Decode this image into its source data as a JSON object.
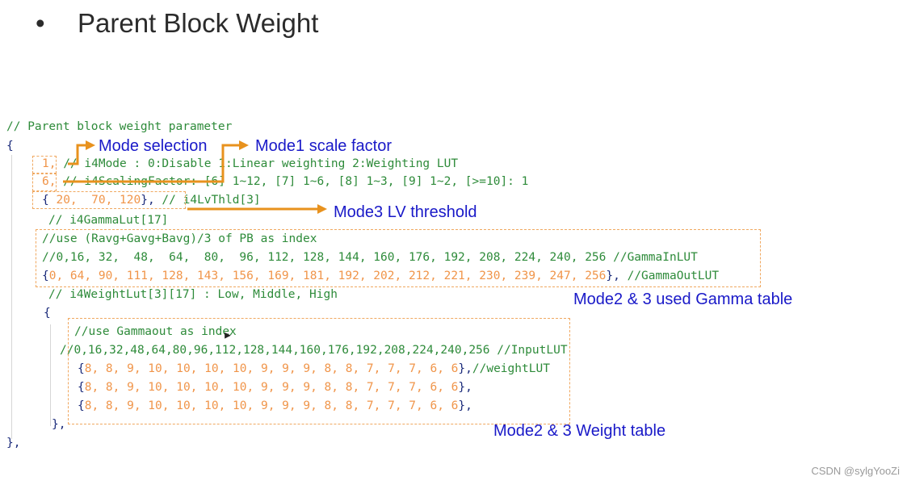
{
  "title": "Parent Block Weight",
  "bullet": "•",
  "code": {
    "header_comment": "// Parent block weight parameter",
    "open_brace": "{",
    "mode_value": "1,",
    "mode_comment": "// i4Mode : 0:Disable 1:Linear weighting 2:Weighting LUT",
    "scaling_value": "6,",
    "scaling_comment": "// i4ScalingFactor: [6] 1~12, [7] 1~6, [8] 1~3, [9] 1~2, [>=10]: 1",
    "lv_open": "{",
    "lv_values": " 20,  70, 120",
    "lv_close": "},",
    "lv_comment": " // i4LvThld[3]",
    "gamma_comment": "// i4GammaLut[17]",
    "gamma_use_comment": "//use (Ravg+Gavg+Bavg)/3 of PB as index",
    "gamma_in": "//0,16, 32,  48,  64,  80,  96, 112, 128, 144, 160, 176, 192, 208, 224, 240, 256",
    "gamma_in_comment": " //GammaInLUT",
    "gamma_out_open": "{",
    "gamma_out_values": "0, 64, 90, 111, 128, 143, 156, 169, 181, 192, 202, 212, 221, 230, 239, 247, 256",
    "gamma_out_close": "},",
    "gamma_out_comment": " //GammaOutLUT",
    "weight_comment": "// i4WeightLut[3][17] : Low, Middle, High",
    "weight_open": "{",
    "weight_use_comment": "//use Gammaout as index",
    "weight_input": "//0,16,32,48,64,80,96,112,128,144,160,176,192,208,224,240,256",
    "weight_input_comment": " //InputLUT",
    "weight_rows": [
      "8, 8, 9, 10, 10, 10, 10, 9, 9, 9, 8, 8, 7, 7, 7, 6, 6",
      "8, 8, 9, 10, 10, 10, 10, 9, 9, 9, 8, 8, 7, 7, 7, 6, 6",
      "8, 8, 9, 10, 10, 10, 10, 9, 9, 9, 8, 8, 7, 7, 7, 6, 6"
    ],
    "row_open": "{",
    "row_close": "},",
    "weight_row_comment": "//weightLUT",
    "weight_close": "},",
    "close_brace": "},"
  },
  "annotations": {
    "mode_selection": "Mode selection",
    "mode1_scale": "Mode1 scale factor",
    "mode3_lv": "Mode3 LV threshold",
    "gamma_table": "Mode2 & 3 used Gamma table",
    "weight_table": "Mode2 & 3 Weight table"
  },
  "colors": {
    "comment": "#2e8b3a",
    "number": "#f0954a",
    "punctuation": "#1a2a7a",
    "annotation": "#1919c8",
    "arrow": "#e8921e"
  },
  "watermark": "CSDN @sylgYooZi"
}
